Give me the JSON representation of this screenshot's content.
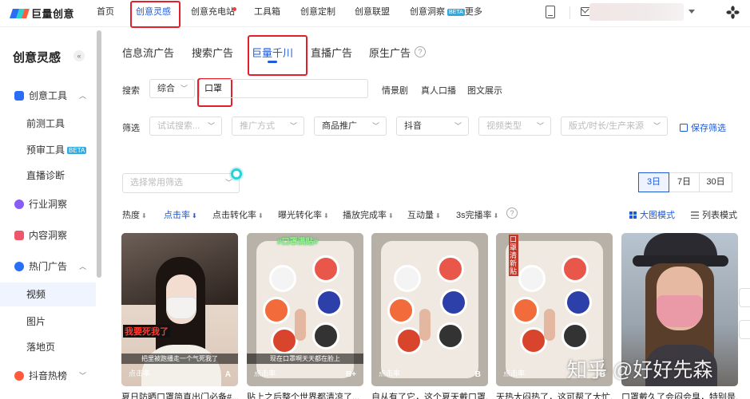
{
  "brand": {
    "name": "巨量创意"
  },
  "topnav": {
    "items": [
      "首页",
      "创意灵感",
      "创意充电站",
      "工具箱",
      "创意定制",
      "创意联盟",
      "创意洞察",
      "更多"
    ],
    "beta_label": "BETA"
  },
  "sidebar": {
    "title": "创意灵感",
    "collapse": "«",
    "items": [
      {
        "label": "创意工具"
      },
      {
        "label": "前测工具"
      },
      {
        "label": "预审工具",
        "badge": "BETA"
      },
      {
        "label": "直播诊断"
      },
      {
        "label": "行业洞察"
      },
      {
        "label": "内容洞察"
      },
      {
        "label": "热门广告"
      },
      {
        "label": "视频"
      },
      {
        "label": "图片"
      },
      {
        "label": "落地页"
      },
      {
        "label": "抖音热榜"
      }
    ]
  },
  "channel_tabs": [
    "信息流广告",
    "搜索广告",
    "巨量千川",
    "直播广告",
    "原生广告"
  ],
  "search": {
    "label": "搜索",
    "scope": "综合",
    "query": "口罩",
    "quick_tags": [
      "情景剧",
      "真人口播",
      "图文展示"
    ]
  },
  "filter": {
    "label": "筛选",
    "selects": [
      "试试搜索...",
      "推广方式",
      "商品推广",
      "抖音",
      "视频类型",
      "版式/时长/生产来源"
    ],
    "save": "保存筛选",
    "common": "选择常用筛选"
  },
  "date_range": {
    "options": [
      "3日",
      "7日",
      "30日"
    ],
    "selected": "3日"
  },
  "sort": {
    "options": [
      "热度",
      "点击率",
      "点击转化率",
      "曝光转化率",
      "播放完成率",
      "互动量",
      "3s完播率"
    ],
    "active": "点击率"
  },
  "views": {
    "grid": "大图模式",
    "list": "列表模式"
  },
  "cards": [
    {
      "label": "点击率",
      "grade": "A",
      "subtitle": "把里被跑播走一个气死我了",
      "overlay_text": "我要死我了",
      "caption": "夏日防晒口罩简直出门必备#..."
    },
    {
      "label": "点击率",
      "grade": "B+",
      "subtitle": "现在口罩啊天天都在脸上",
      "overlay_text": "#口罩满贴#",
      "caption": "贴上之后整个世界都清凉了..."
    },
    {
      "label": "点击率",
      "grade": "B",
      "subtitle": "",
      "overlay_text": "",
      "caption": "自从有了它，这个夏天戴口罩..."
    },
    {
      "label": "点击率",
      "grade": "B",
      "subtitle": "",
      "overlay_text": "口罩清新贴",
      "caption": "天热大闷热了，这可帮了大忙..."
    },
    {
      "label": "",
      "grade": "",
      "subtitle": "",
      "overlay_text": "",
      "caption": "口罩戴久了会闷会臭，特别是..."
    }
  ],
  "watermark": "知乎 @好好先森",
  "colors": {
    "accent": "#1f5bd6",
    "highlight": "#e41f2b",
    "teal": "#29d2d8"
  }
}
